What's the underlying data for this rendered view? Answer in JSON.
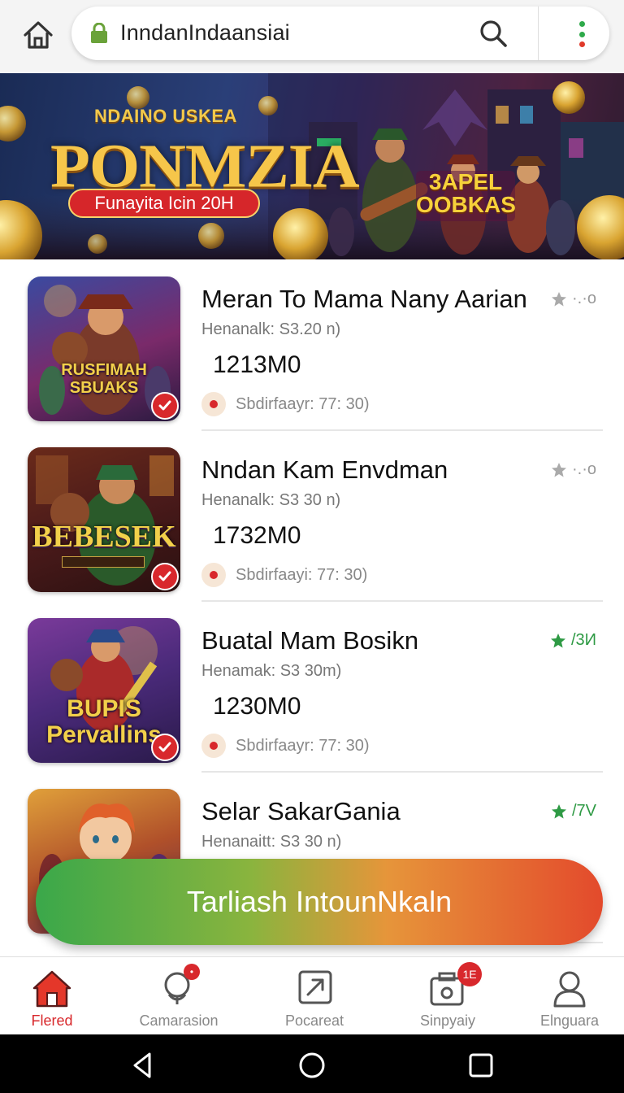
{
  "browser": {
    "url_text": "InndanIndaansiai",
    "home_icon": "home-icon",
    "lock_icon": "lock-icon",
    "search_icon": "search-icon",
    "menu_icon": "kebab-menu-icon"
  },
  "banner": {
    "kicker": "NDAINO USKEA",
    "title": "PONMZIA",
    "cta": "Funayita Icin 20H",
    "badge_line1": "3APEL",
    "badge_line2": "OOBKAS"
  },
  "list": {
    "items": [
      {
        "thumb_text": "RUSFIMAH SBUAKS",
        "title": "Meran To Mama Nany Aarian",
        "subtitle": "Henanalk: S3.20 n)",
        "amount": "1213M0",
        "status": "Sbdirfaayr: 77: 30)",
        "rating": "·.·o",
        "rating_style": "grey"
      },
      {
        "thumb_text": "BEBESEK",
        "title": "Nndan Kam Envdman",
        "subtitle": "Henanalk: S3 30 n)",
        "amount": "1732M0",
        "status": "Sbdirfaayi: 77: 30)",
        "rating": "·.·o",
        "rating_style": "grey"
      },
      {
        "thumb_text": "BUPIS Pervallins",
        "title": "Buatal Mam Bosikn",
        "subtitle": "Henamak: S3 30m)",
        "amount": "1230M0",
        "status": "Sbdirfaayr: 77: 30)",
        "rating": "/3И",
        "rating_style": "green"
      },
      {
        "thumb_text": "",
        "title": "Selar SakarGania",
        "subtitle": "Henanaitt: S3 30 n)",
        "amount": "",
        "status": "",
        "rating": "/7V",
        "rating_style": "green"
      }
    ]
  },
  "cta": {
    "label": "Tarliash IntounNkaln"
  },
  "bottom_nav": {
    "items": [
      {
        "label": "Flered",
        "icon": "home-icon",
        "active": true,
        "badge": ""
      },
      {
        "label": "Camarasion",
        "icon": "chat-icon",
        "active": false,
        "badge": "•"
      },
      {
        "label": "Pocareat",
        "icon": "share-icon",
        "active": false,
        "badge": ""
      },
      {
        "label": "Sinpyaiy",
        "icon": "wallet-icon",
        "active": false,
        "badge": "1E"
      },
      {
        "label": "Elnguara",
        "icon": "user-icon",
        "active": false,
        "badge": ""
      }
    ]
  },
  "colors": {
    "accent_red": "#d8282c",
    "accent_green": "#2e9a44",
    "cta_gradient_start": "#3aa84a",
    "cta_gradient_end": "#e34a2c"
  }
}
